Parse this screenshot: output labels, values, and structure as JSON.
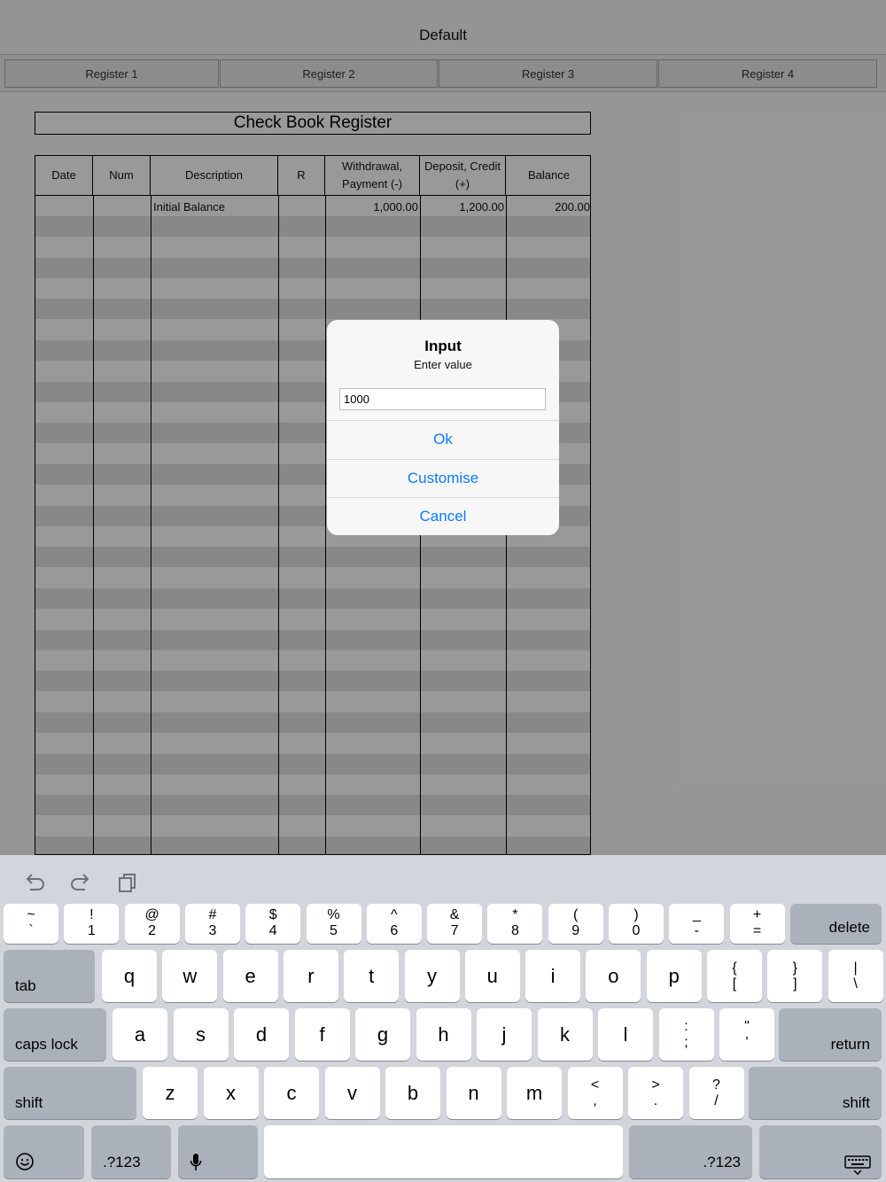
{
  "navbar": {
    "title": "Default"
  },
  "tabs": [
    {
      "label": "Register 1"
    },
    {
      "label": "Register 2"
    },
    {
      "label": "Register 3"
    },
    {
      "label": "Register 4"
    }
  ],
  "sheet": {
    "title": "Check Book Register",
    "columns": [
      {
        "label": "Date"
      },
      {
        "label": "Num"
      },
      {
        "label": "Description"
      },
      {
        "label": "R"
      },
      {
        "label": "Withdrawal, Payment (-)"
      },
      {
        "label": "Deposit, Credit (+)"
      },
      {
        "label": "Balance"
      }
    ],
    "rows": [
      {
        "date": "",
        "num": "",
        "description": "Initial Balance",
        "r": "",
        "withdrawal": "1,000.00",
        "deposit": "1,200.00",
        "balance": "200.00"
      }
    ]
  },
  "dialog": {
    "title": "Input",
    "message": "Enter value",
    "input_value": "1000",
    "ok_label": "Ok",
    "customise_label": "Customise",
    "cancel_label": "Cancel"
  },
  "keyboard": {
    "shortcuts": [
      "undo-icon",
      "redo-icon",
      "paste-icon"
    ],
    "row1": [
      "~\n`",
      "!\n1",
      "@\n2",
      "#\n3",
      "$\n4",
      "%\n5",
      "^\n6",
      "&\n7",
      "*\n8",
      "(\n9",
      ")\n0",
      "_\n-",
      "+\n="
    ],
    "delete_label": "delete",
    "tab_label": "tab",
    "row2": [
      "q",
      "w",
      "e",
      "r",
      "t",
      "y",
      "u",
      "i",
      "o",
      "p",
      "{\n[",
      "}\n]",
      "|\n\\"
    ],
    "caps_label": "caps lock",
    "row3": [
      "a",
      "s",
      "d",
      "f",
      "g",
      "h",
      "j",
      "k",
      "l",
      ":\n;",
      "\"\n'"
    ],
    "return_label": "return",
    "shift_label": "shift",
    "row4": [
      "z",
      "x",
      "c",
      "v",
      "b",
      "n",
      "m",
      "<\n,",
      ">\n.",
      "?\n/"
    ],
    "num_label": ".?123",
    "bottom_icons": [
      "emoji-icon",
      "microphone-icon",
      "hide-keyboard-icon"
    ]
  }
}
